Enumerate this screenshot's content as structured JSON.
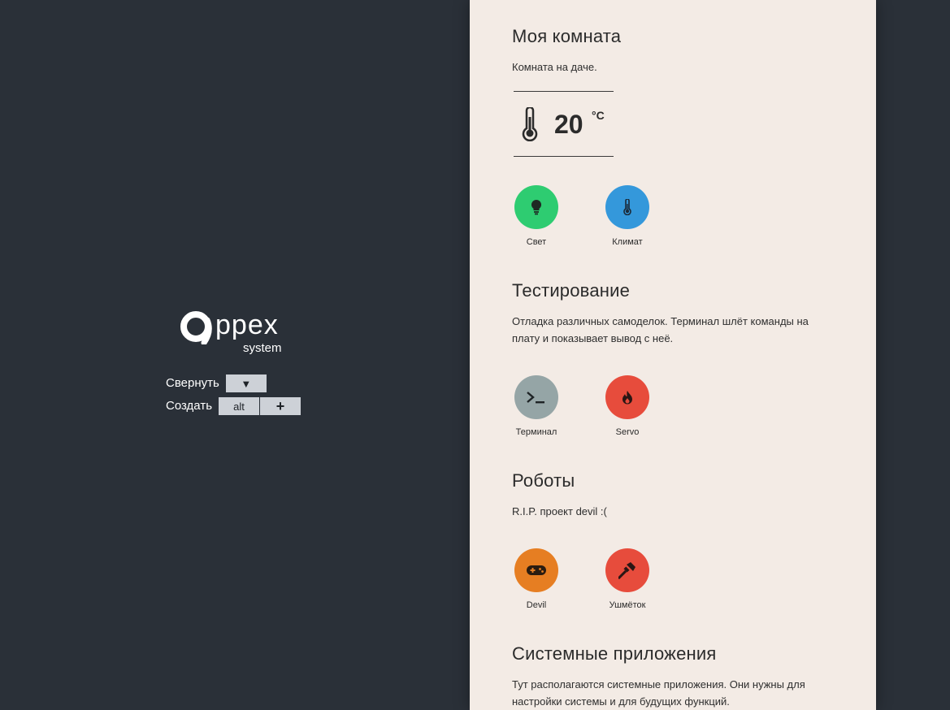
{
  "sidebar": {
    "logo_word": "ppex",
    "logo_sub": "system",
    "collapse_label": "Свернуть",
    "collapse_button": "▼",
    "create_label": "Создать",
    "alt_button": "alt",
    "plus_button": "+"
  },
  "sections": [
    {
      "title": "Моя комната",
      "description": "Комната на даче.",
      "temperature": {
        "value": "20",
        "unit": "°C"
      },
      "apps": [
        {
          "label": "Свет",
          "icon": "lightbulb-icon",
          "color": "#2ecc71"
        },
        {
          "label": "Климат",
          "icon": "thermometer-icon",
          "color": "#3498db"
        }
      ]
    },
    {
      "title": "Тестирование",
      "description": "Отладка различных самоделок. Терминал шлёт команды на плату и показывает вывод с неё.",
      "apps": [
        {
          "label": "Терминал",
          "icon": "terminal-icon",
          "color": "#95a5a6"
        },
        {
          "label": "Servo",
          "icon": "fire-icon",
          "color": "#e74c3c"
        }
      ]
    },
    {
      "title": "Роботы",
      "description": "R.I.P. проект devil :(",
      "apps": [
        {
          "label": "Devil",
          "icon": "gamepad-icon",
          "color": "#e67e22"
        },
        {
          "label": "Ушмёток",
          "icon": "hammer-icon",
          "color": "#e74c3c"
        }
      ]
    },
    {
      "title": "Системные приложения",
      "description": "Тут располагаются системные приложения. Они нужны для настройки системы и для будущих функций."
    }
  ]
}
